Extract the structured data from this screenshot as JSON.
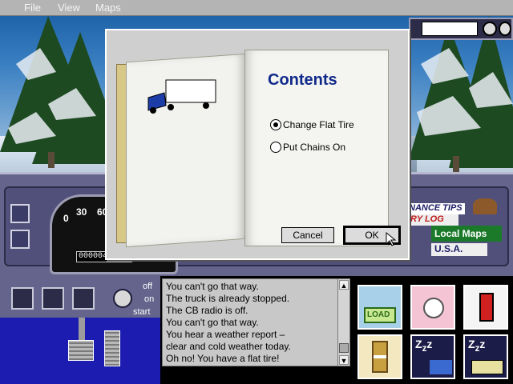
{
  "menu": {
    "file": "File",
    "view": "View",
    "maps": "Maps"
  },
  "dashboard": {
    "speedometer": {
      "label_0": "0",
      "label_30": "30",
      "label_60": "60",
      "odometer": "000004"
    },
    "signs": {
      "maintenance_tips": "NANCE TIPS",
      "daily_log": "RY LOG",
      "local_maps": "Local Maps",
      "usa": "U.S.A."
    }
  },
  "ignition": {
    "off": "off",
    "on": "on",
    "start": "start"
  },
  "message_log": [
    "You can't go that way.",
    "The truck is already stopped.",
    "The CB radio is off.",
    "You can't go that way.",
    "You hear a weather report –",
    "clear and cold weather today.",
    "Oh no! You have a flat tire!"
  ],
  "actions": {
    "load_label": "LOAD"
  },
  "dialog": {
    "title": "Contents",
    "options": [
      {
        "label": "Change Flat Tire",
        "selected": true
      },
      {
        "label": "Put Chains On",
        "selected": false
      }
    ],
    "cancel": "Cancel",
    "ok": "OK"
  },
  "colors": {
    "dashboard": "#64648c",
    "title_blue": "#102a8a",
    "menubar": "#b4b4b4"
  }
}
